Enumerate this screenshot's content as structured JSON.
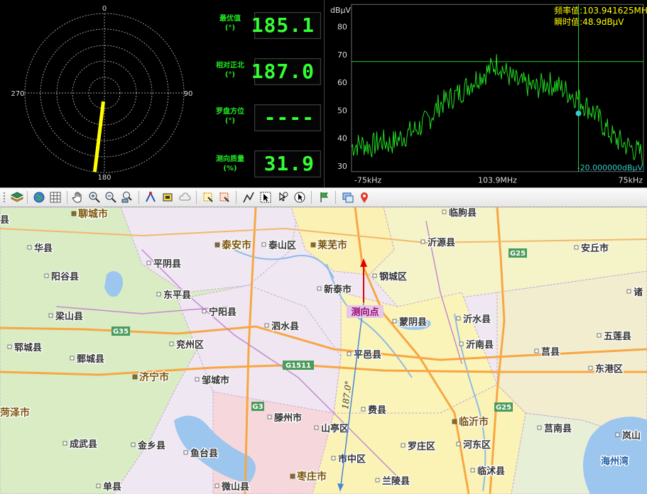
{
  "compass": {
    "labels": {
      "north": "0",
      "east": "90",
      "south": "180",
      "west": "270"
    },
    "bearing_deg": 187.0,
    "needle_color": "#ffff00"
  },
  "readouts": [
    {
      "label_line1": "最优值",
      "label_line2": "(°)",
      "value": "185.1"
    },
    {
      "label_line1": "相对正北",
      "label_line2": "(°)",
      "value": "187.0"
    },
    {
      "label_line1": "罗盘方位",
      "label_line2": "(°)",
      "value": "----"
    },
    {
      "label_line1": "测向质量",
      "label_line2": "(%)",
      "value": "31.9"
    }
  ],
  "spectrum": {
    "unit_label": "dBμV",
    "freq_readout": "频率值:103.941625MH",
    "level_readout": "瞬时值:48.9dBμV",
    "y_ticks": [
      "80",
      "70",
      "60",
      "50",
      "40",
      "30"
    ],
    "x_left": "-75kHz",
    "x_center": "103.9MHz",
    "x_right": "75kHz",
    "threshold_readout": "-20.000000dBμV",
    "trace_color": "#22dd22",
    "marker_color": "#33cccc",
    "chart_data": {
      "type": "line",
      "xlabel": "",
      "ylabel": "dBμV",
      "xlim": [
        -75,
        75
      ],
      "ylim": [
        28,
        88
      ],
      "x_unit": "kHz offset from 103.9MHz",
      "threshold_line_dbuv": 67.5,
      "marker": {
        "x": 41.6,
        "y": 48.9
      },
      "series": [
        {
          "x": [
            -75,
            -70,
            -65,
            -60,
            -55,
            -50,
            -45,
            -40,
            -35,
            -30,
            -25,
            -20,
            -15,
            -10,
            -5,
            0,
            5,
            10,
            15,
            20,
            25,
            30,
            35,
            40,
            45,
            50,
            55,
            60,
            65,
            70,
            75
          ],
          "values": [
            37,
            38,
            37,
            39,
            38,
            40,
            42,
            44,
            47,
            52,
            54,
            56,
            59,
            62,
            64,
            67,
            63,
            60,
            59,
            58,
            60,
            59,
            57,
            55,
            52,
            49,
            44,
            40,
            38,
            36,
            34
          ]
        }
      ]
    }
  },
  "toolbar": {
    "icons": [
      "layers-icon",
      "globe-icon",
      "grid-icon",
      "pan-hand-icon",
      "zoom-in-icon",
      "zoom-out-icon",
      "zoom-extent-icon",
      "route-icon",
      "toll-icon",
      "cloud-shape-icon",
      "select-a-icon",
      "select-b-icon",
      "polyline-icon",
      "arrow-select-icon",
      "zoom-select-icon",
      "pointer-icon",
      "flag-icon",
      "layer-window-icon",
      "location-pin-icon"
    ]
  },
  "map": {
    "highways": [
      "G35",
      "G1511",
      "G25",
      "G25",
      "G3"
    ],
    "places": [
      {
        "name": "聊城市",
        "kind": "city"
      },
      {
        "name": "泰山区",
        "kind": "district"
      },
      {
        "name": "莱芜市",
        "kind": "city"
      },
      {
        "name": "泰安市",
        "kind": "city"
      },
      {
        "name": "临朐县",
        "kind": "county"
      },
      {
        "name": "沂源县",
        "kind": "county"
      },
      {
        "name": "安丘市",
        "kind": "county"
      },
      {
        "name": "华县",
        "kind": "county"
      },
      {
        "name": "阳谷县",
        "kind": "county"
      },
      {
        "name": "平阴县",
        "kind": "county"
      },
      {
        "name": "钢城区",
        "kind": "district"
      },
      {
        "name": "东平县",
        "kind": "county"
      },
      {
        "name": "新泰市",
        "kind": "county"
      },
      {
        "name": "宁阳县",
        "kind": "county"
      },
      {
        "name": "梁山县",
        "kind": "county"
      },
      {
        "name": "蒙阴县",
        "kind": "county"
      },
      {
        "name": "沂水县",
        "kind": "county"
      },
      {
        "name": "泗水县",
        "kind": "county"
      },
      {
        "name": "五莲县",
        "kind": "county"
      },
      {
        "name": "郓城县",
        "kind": "county"
      },
      {
        "name": "兖州区",
        "kind": "district"
      },
      {
        "name": "沂南县",
        "kind": "county"
      },
      {
        "name": "莒县",
        "kind": "county"
      },
      {
        "name": "鄄城县",
        "kind": "county"
      },
      {
        "name": "平邑县",
        "kind": "county"
      },
      {
        "name": "东港区",
        "kind": "district"
      },
      {
        "name": "济宁市",
        "kind": "city"
      },
      {
        "name": "邹城市",
        "kind": "county"
      },
      {
        "name": "费县",
        "kind": "county"
      },
      {
        "name": "菏泽市",
        "kind": "city"
      },
      {
        "name": "滕州市",
        "kind": "county"
      },
      {
        "name": "临沂市",
        "kind": "city"
      },
      {
        "name": "山亭区",
        "kind": "district"
      },
      {
        "name": "莒南县",
        "kind": "county"
      },
      {
        "name": "岚山",
        "kind": "district"
      },
      {
        "name": "成武县",
        "kind": "county"
      },
      {
        "name": "金乡县",
        "kind": "county"
      },
      {
        "name": "鱼台县",
        "kind": "county"
      },
      {
        "name": "市中区",
        "kind": "district"
      },
      {
        "name": "罗庄区",
        "kind": "district"
      },
      {
        "name": "河东区",
        "kind": "district"
      },
      {
        "name": "海州湾",
        "kind": "water"
      },
      {
        "name": "枣庄市",
        "kind": "city"
      },
      {
        "name": "临沭县",
        "kind": "county"
      },
      {
        "name": "单县",
        "kind": "county"
      },
      {
        "name": "微山县",
        "kind": "county"
      },
      {
        "name": "兰陵县",
        "kind": "county"
      },
      {
        "name": "县",
        "kind": "county"
      },
      {
        "name": "诸",
        "kind": "county"
      }
    ],
    "station_label": "测向点",
    "bearing_label": "187.0°",
    "north_arrow_color": "#e00000",
    "bearing_line_color": "#4a86d8"
  }
}
